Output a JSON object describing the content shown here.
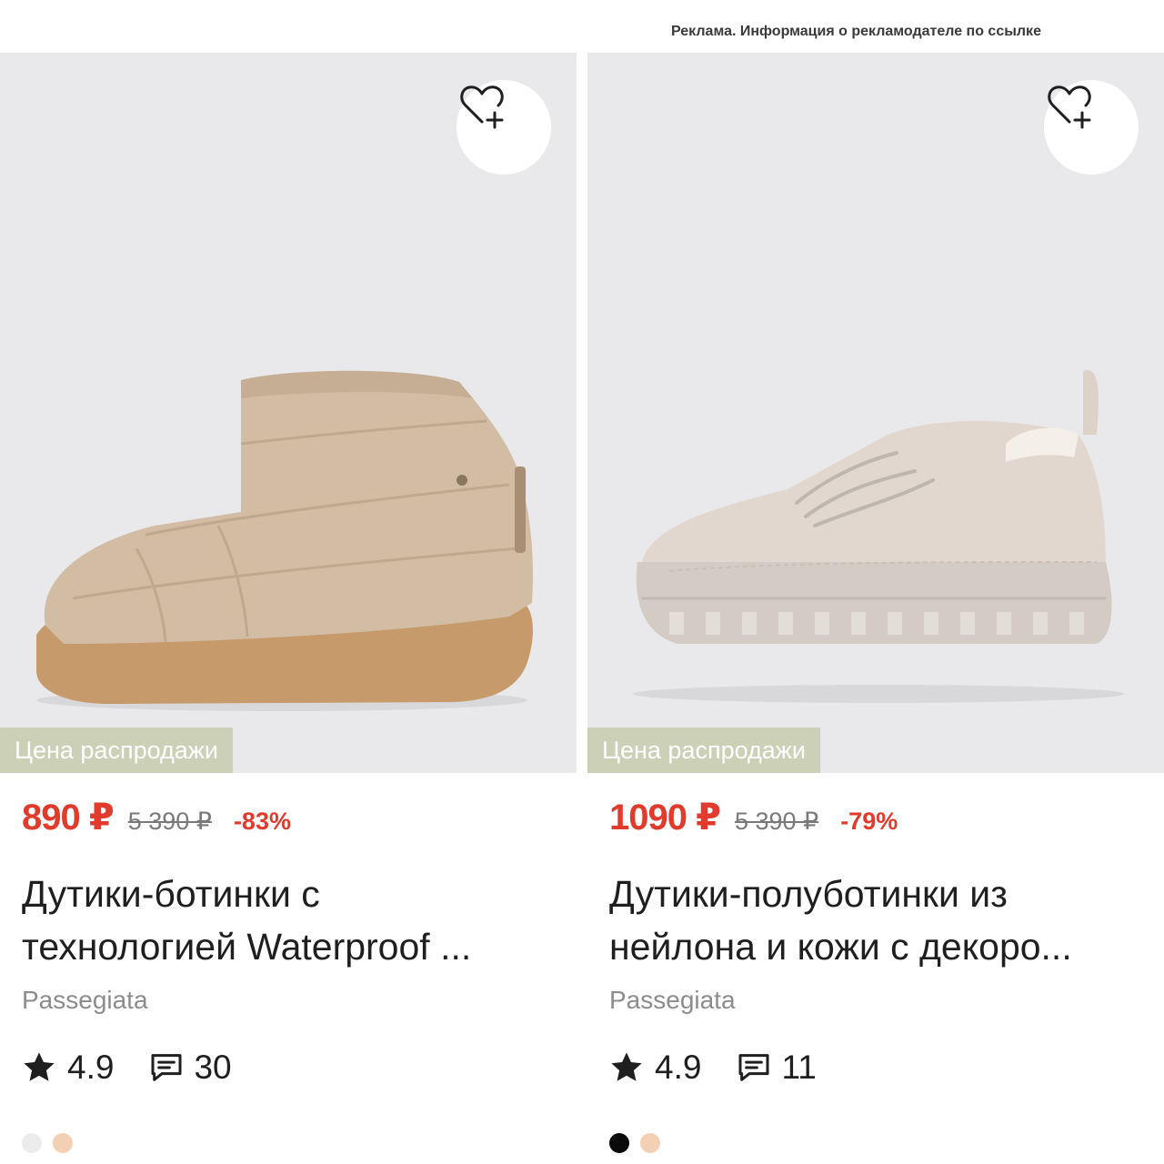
{
  "ad_notice": "Реклама. Информация о рекламодателе по ссылке",
  "products": [
    {
      "badge": "Цена распродажи",
      "price": "890 ₽",
      "old_price": "5 390 ₽",
      "discount": "-83%",
      "title_line1": "Дутики-ботинки с",
      "title_line2": "технологией Waterproof ...",
      "brand": "Passegiata",
      "rating": "4.9",
      "reviews": "30",
      "swatches": [
        "#ececec",
        "#f3cfb3"
      ],
      "favorite_icon": "heart-plus-icon"
    },
    {
      "badge": "Цена распродажи",
      "price": "1090 ₽",
      "old_price": "5 390 ₽",
      "discount": "-79%",
      "title_line1": "Дутики-полуботинки из",
      "title_line2": "нейлона и кожи с декоро...",
      "brand": "Passegiata",
      "rating": "4.9",
      "reviews": "11",
      "swatches": [
        "#0a0a0a",
        "#f3cfb3"
      ],
      "favorite_icon": "heart-plus-icon"
    }
  ],
  "colors": {
    "price_red": "#e03b2d",
    "badge_bg": "#ccd0b6",
    "photo_bg": "#e9e9eb"
  }
}
